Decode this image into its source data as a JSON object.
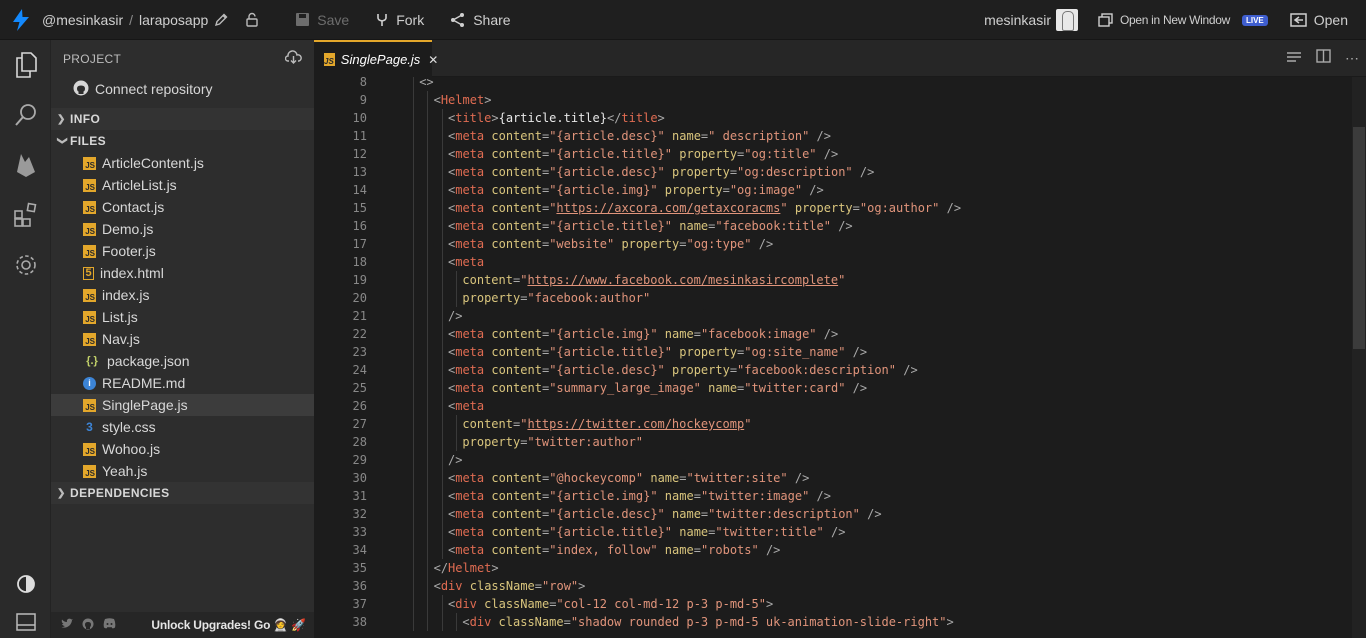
{
  "topbar": {
    "user": "@mesinkasir",
    "sep": "/",
    "project": "laraposapp",
    "save": "Save",
    "fork": "Fork",
    "share": "Share",
    "username": "mesinkasir",
    "open_new_window": "Open in New Window",
    "live": "LIVE",
    "open": "Open"
  },
  "activity": [
    "files-icon",
    "search-icon",
    "firebase-icon",
    "extensions-icon",
    "settings-icon",
    "theme-toggle-icon",
    "layout-icon"
  ],
  "sidebar": {
    "project_label": "PROJECT",
    "connect": "Connect repository",
    "info": "INFO",
    "files_label": "FILES",
    "files": [
      {
        "name": "ArticleContent.js",
        "type": "js"
      },
      {
        "name": "ArticleList.js",
        "type": "js"
      },
      {
        "name": "Contact.js",
        "type": "js"
      },
      {
        "name": "Demo.js",
        "type": "js"
      },
      {
        "name": "Footer.js",
        "type": "js"
      },
      {
        "name": "index.html",
        "type": "html"
      },
      {
        "name": "index.js",
        "type": "js"
      },
      {
        "name": "List.js",
        "type": "js"
      },
      {
        "name": "Nav.js",
        "type": "js"
      },
      {
        "name": "package.json",
        "type": "json"
      },
      {
        "name": "README.md",
        "type": "md"
      },
      {
        "name": "SinglePage.js",
        "type": "js",
        "active": true
      },
      {
        "name": "style.css",
        "type": "css"
      },
      {
        "name": "Wohoo.js",
        "type": "js"
      },
      {
        "name": "Yeah.js",
        "type": "js"
      }
    ],
    "dependencies": "DEPENDENCIES",
    "upgrade": "Unlock Upgrades! Go 🧑‍🚀 🚀"
  },
  "editor": {
    "tab_label": "SinglePage.js",
    "tab_close": "✕",
    "lines": [
      {
        "n": "8",
        "indent": 1,
        "tokens": [
          [
            "pun",
            "<>"
          ]
        ]
      },
      {
        "n": "9",
        "indent": 2,
        "tokens": [
          [
            "pun",
            "<"
          ],
          [
            "tag",
            "Helmet"
          ],
          [
            "pun",
            ">"
          ]
        ]
      },
      {
        "n": "10",
        "indent": 3,
        "tokens": [
          [
            "pun",
            "<"
          ],
          [
            "tag",
            "title"
          ],
          [
            "pun",
            ">"
          ],
          [
            "text",
            "{article.title}"
          ],
          [
            "pun",
            "</"
          ],
          [
            "tag",
            "title"
          ],
          [
            "pun",
            ">"
          ]
        ]
      },
      {
        "n": "11",
        "indent": 3,
        "tokens": [
          [
            "pun",
            "<"
          ],
          [
            "tag",
            "meta"
          ],
          [
            "plain",
            " "
          ],
          [
            "attr",
            "content"
          ],
          [
            "pun",
            "="
          ],
          [
            "str",
            "\"{article.desc}\""
          ],
          [
            "plain",
            " "
          ],
          [
            "attr",
            "name"
          ],
          [
            "pun",
            "="
          ],
          [
            "str",
            "\" description\""
          ],
          [
            "pun",
            " />"
          ]
        ]
      },
      {
        "n": "12",
        "indent": 3,
        "tokens": [
          [
            "pun",
            "<"
          ],
          [
            "tag",
            "meta"
          ],
          [
            "plain",
            " "
          ],
          [
            "attr",
            "content"
          ],
          [
            "pun",
            "="
          ],
          [
            "str",
            "\"{article.title}\""
          ],
          [
            "plain",
            " "
          ],
          [
            "attr",
            "property"
          ],
          [
            "pun",
            "="
          ],
          [
            "str",
            "\"og:title\""
          ],
          [
            "pun",
            " />"
          ]
        ]
      },
      {
        "n": "13",
        "indent": 3,
        "tokens": [
          [
            "pun",
            "<"
          ],
          [
            "tag",
            "meta"
          ],
          [
            "plain",
            " "
          ],
          [
            "attr",
            "content"
          ],
          [
            "pun",
            "="
          ],
          [
            "str",
            "\"{article.desc}\""
          ],
          [
            "plain",
            " "
          ],
          [
            "attr",
            "property"
          ],
          [
            "pun",
            "="
          ],
          [
            "str",
            "\"og:description\""
          ],
          [
            "pun",
            " />"
          ]
        ]
      },
      {
        "n": "14",
        "indent": 3,
        "tokens": [
          [
            "pun",
            "<"
          ],
          [
            "tag",
            "meta"
          ],
          [
            "plain",
            " "
          ],
          [
            "attr",
            "content"
          ],
          [
            "pun",
            "="
          ],
          [
            "str",
            "\"{article.img}\""
          ],
          [
            "plain",
            " "
          ],
          [
            "attr",
            "property"
          ],
          [
            "pun",
            "="
          ],
          [
            "str",
            "\"og:image\""
          ],
          [
            "pun",
            " />"
          ]
        ]
      },
      {
        "n": "15",
        "indent": 3,
        "tokens": [
          [
            "pun",
            "<"
          ],
          [
            "tag",
            "meta"
          ],
          [
            "plain",
            " "
          ],
          [
            "attr",
            "content"
          ],
          [
            "pun",
            "="
          ],
          [
            "str",
            "\""
          ],
          [
            "url",
            "https://axcora.com/getaxcoracms"
          ],
          [
            "str",
            "\""
          ],
          [
            "plain",
            " "
          ],
          [
            "attr",
            "property"
          ],
          [
            "pun",
            "="
          ],
          [
            "str",
            "\"og:author\""
          ],
          [
            "pun",
            " />"
          ]
        ]
      },
      {
        "n": "16",
        "indent": 3,
        "tokens": [
          [
            "pun",
            "<"
          ],
          [
            "tag",
            "meta"
          ],
          [
            "plain",
            " "
          ],
          [
            "attr",
            "content"
          ],
          [
            "pun",
            "="
          ],
          [
            "str",
            "\"{article.title}\""
          ],
          [
            "plain",
            " "
          ],
          [
            "attr",
            "name"
          ],
          [
            "pun",
            "="
          ],
          [
            "str",
            "\"facebook:title\""
          ],
          [
            "pun",
            " />"
          ]
        ]
      },
      {
        "n": "17",
        "indent": 3,
        "tokens": [
          [
            "pun",
            "<"
          ],
          [
            "tag",
            "meta"
          ],
          [
            "plain",
            " "
          ],
          [
            "attr",
            "content"
          ],
          [
            "pun",
            "="
          ],
          [
            "str",
            "\"website\""
          ],
          [
            "plain",
            " "
          ],
          [
            "attr",
            "property"
          ],
          [
            "pun",
            "="
          ],
          [
            "str",
            "\"og:type\""
          ],
          [
            "pun",
            " />"
          ]
        ]
      },
      {
        "n": "18",
        "indent": 3,
        "tokens": [
          [
            "pun",
            "<"
          ],
          [
            "tag",
            "meta"
          ]
        ]
      },
      {
        "n": "19",
        "indent": 4,
        "tokens": [
          [
            "attr",
            "content"
          ],
          [
            "pun",
            "="
          ],
          [
            "str",
            "\""
          ],
          [
            "url",
            "https://www.facebook.com/mesinkasircomplete"
          ],
          [
            "str",
            "\""
          ]
        ]
      },
      {
        "n": "20",
        "indent": 4,
        "tokens": [
          [
            "attr",
            "property"
          ],
          [
            "pun",
            "="
          ],
          [
            "str",
            "\"facebook:author\""
          ]
        ]
      },
      {
        "n": "21",
        "indent": 3,
        "tokens": [
          [
            "pun",
            "/>"
          ]
        ]
      },
      {
        "n": "22",
        "indent": 3,
        "tokens": [
          [
            "pun",
            "<"
          ],
          [
            "tag",
            "meta"
          ],
          [
            "plain",
            " "
          ],
          [
            "attr",
            "content"
          ],
          [
            "pun",
            "="
          ],
          [
            "str",
            "\"{article.img}\""
          ],
          [
            "plain",
            " "
          ],
          [
            "attr",
            "name"
          ],
          [
            "pun",
            "="
          ],
          [
            "str",
            "\"facebook:image\""
          ],
          [
            "pun",
            " />"
          ]
        ]
      },
      {
        "n": "23",
        "indent": 3,
        "tokens": [
          [
            "pun",
            "<"
          ],
          [
            "tag",
            "meta"
          ],
          [
            "plain",
            " "
          ],
          [
            "attr",
            "content"
          ],
          [
            "pun",
            "="
          ],
          [
            "str",
            "\"{article.title}\""
          ],
          [
            "plain",
            " "
          ],
          [
            "attr",
            "property"
          ],
          [
            "pun",
            "="
          ],
          [
            "str",
            "\"og:site_name\""
          ],
          [
            "pun",
            " />"
          ]
        ]
      },
      {
        "n": "24",
        "indent": 3,
        "tokens": [
          [
            "pun",
            "<"
          ],
          [
            "tag",
            "meta"
          ],
          [
            "plain",
            " "
          ],
          [
            "attr",
            "content"
          ],
          [
            "pun",
            "="
          ],
          [
            "str",
            "\"{article.desc}\""
          ],
          [
            "plain",
            " "
          ],
          [
            "attr",
            "property"
          ],
          [
            "pun",
            "="
          ],
          [
            "str",
            "\"facebook:description\""
          ],
          [
            "pun",
            " />"
          ]
        ]
      },
      {
        "n": "25",
        "indent": 3,
        "tokens": [
          [
            "pun",
            "<"
          ],
          [
            "tag",
            "meta"
          ],
          [
            "plain",
            " "
          ],
          [
            "attr",
            "content"
          ],
          [
            "pun",
            "="
          ],
          [
            "str",
            "\"summary_large_image\""
          ],
          [
            "plain",
            " "
          ],
          [
            "attr",
            "name"
          ],
          [
            "pun",
            "="
          ],
          [
            "str",
            "\"twitter:card\""
          ],
          [
            "pun",
            " />"
          ]
        ]
      },
      {
        "n": "26",
        "indent": 3,
        "tokens": [
          [
            "pun",
            "<"
          ],
          [
            "tag",
            "meta"
          ]
        ]
      },
      {
        "n": "27",
        "indent": 4,
        "tokens": [
          [
            "attr",
            "content"
          ],
          [
            "pun",
            "="
          ],
          [
            "str",
            "\""
          ],
          [
            "url",
            "https://twitter.com/hockeycomp"
          ],
          [
            "str",
            "\""
          ]
        ]
      },
      {
        "n": "28",
        "indent": 4,
        "tokens": [
          [
            "attr",
            "property"
          ],
          [
            "pun",
            "="
          ],
          [
            "str",
            "\"twitter:author\""
          ]
        ]
      },
      {
        "n": "29",
        "indent": 3,
        "tokens": [
          [
            "pun",
            "/>"
          ]
        ]
      },
      {
        "n": "30",
        "indent": 3,
        "tokens": [
          [
            "pun",
            "<"
          ],
          [
            "tag",
            "meta"
          ],
          [
            "plain",
            " "
          ],
          [
            "attr",
            "content"
          ],
          [
            "pun",
            "="
          ],
          [
            "str",
            "\"@hockeycomp\""
          ],
          [
            "plain",
            " "
          ],
          [
            "attr",
            "name"
          ],
          [
            "pun",
            "="
          ],
          [
            "str",
            "\"twitter:site\""
          ],
          [
            "pun",
            " />"
          ]
        ]
      },
      {
        "n": "31",
        "indent": 3,
        "tokens": [
          [
            "pun",
            "<"
          ],
          [
            "tag",
            "meta"
          ],
          [
            "plain",
            " "
          ],
          [
            "attr",
            "content"
          ],
          [
            "pun",
            "="
          ],
          [
            "str",
            "\"{article.img}\""
          ],
          [
            "plain",
            " "
          ],
          [
            "attr",
            "name"
          ],
          [
            "pun",
            "="
          ],
          [
            "str",
            "\"twitter:image\""
          ],
          [
            "pun",
            " />"
          ]
        ]
      },
      {
        "n": "32",
        "indent": 3,
        "tokens": [
          [
            "pun",
            "<"
          ],
          [
            "tag",
            "meta"
          ],
          [
            "plain",
            " "
          ],
          [
            "attr",
            "content"
          ],
          [
            "pun",
            "="
          ],
          [
            "str",
            "\"{article.desc}\""
          ],
          [
            "plain",
            " "
          ],
          [
            "attr",
            "name"
          ],
          [
            "pun",
            "="
          ],
          [
            "str",
            "\"twitter:description\""
          ],
          [
            "pun",
            " />"
          ]
        ]
      },
      {
        "n": "33",
        "indent": 3,
        "tokens": [
          [
            "pun",
            "<"
          ],
          [
            "tag",
            "meta"
          ],
          [
            "plain",
            " "
          ],
          [
            "attr",
            "content"
          ],
          [
            "pun",
            "="
          ],
          [
            "str",
            "\"{article.title}\""
          ],
          [
            "plain",
            " "
          ],
          [
            "attr",
            "name"
          ],
          [
            "pun",
            "="
          ],
          [
            "str",
            "\"twitter:title\""
          ],
          [
            "pun",
            " />"
          ]
        ]
      },
      {
        "n": "34",
        "indent": 3,
        "tokens": [
          [
            "pun",
            "<"
          ],
          [
            "tag",
            "meta"
          ],
          [
            "plain",
            " "
          ],
          [
            "attr",
            "content"
          ],
          [
            "pun",
            "="
          ],
          [
            "str",
            "\"index, follow\""
          ],
          [
            "plain",
            " "
          ],
          [
            "attr",
            "name"
          ],
          [
            "pun",
            "="
          ],
          [
            "str",
            "\"robots\""
          ],
          [
            "pun",
            " />"
          ]
        ]
      },
      {
        "n": "35",
        "indent": 2,
        "tokens": [
          [
            "pun",
            "</"
          ],
          [
            "tag",
            "Helmet"
          ],
          [
            "pun",
            ">"
          ]
        ]
      },
      {
        "n": "36",
        "indent": 2,
        "tokens": [
          [
            "pun",
            "<"
          ],
          [
            "tag",
            "div"
          ],
          [
            "plain",
            " "
          ],
          [
            "attr",
            "className"
          ],
          [
            "pun",
            "="
          ],
          [
            "str",
            "\"row\""
          ],
          [
            "pun",
            ">"
          ]
        ]
      },
      {
        "n": "37",
        "indent": 3,
        "tokens": [
          [
            "pun",
            "<"
          ],
          [
            "tag",
            "div"
          ],
          [
            "plain",
            " "
          ],
          [
            "attr",
            "className"
          ],
          [
            "pun",
            "="
          ],
          [
            "str",
            "\"col-12 col-md-12 p-3 p-md-5\""
          ],
          [
            "pun",
            ">"
          ]
        ]
      },
      {
        "n": "38",
        "indent": 4,
        "tokens": [
          [
            "pun",
            "<"
          ],
          [
            "tag",
            "div"
          ],
          [
            "plain",
            " "
          ],
          [
            "attr",
            "className"
          ],
          [
            "pun",
            "="
          ],
          [
            "str",
            "\"shadow rounded p-3 p-md-5 uk-animation-slide-right\""
          ],
          [
            "pun",
            ">"
          ]
        ]
      }
    ]
  },
  "colors": {
    "accent": "#e3a72b",
    "js_icon": "#e3a72b",
    "live_badge": "#3f5ecf"
  }
}
